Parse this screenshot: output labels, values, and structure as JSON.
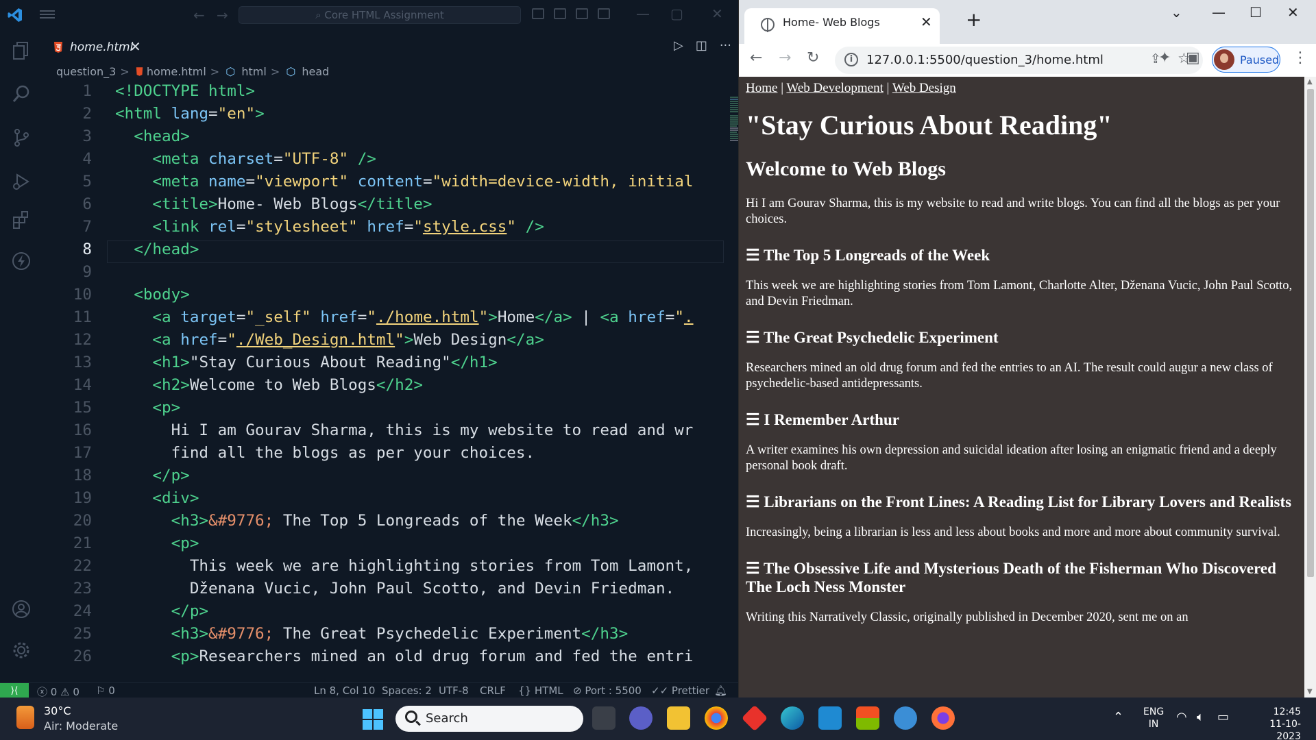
{
  "vscode": {
    "title_search": "Core HTML Assignment",
    "tab": {
      "label": "home.html"
    },
    "breadcrumb": [
      "question_3",
      "home.html",
      "html",
      "head"
    ],
    "cursor_line": 8,
    "lines": [
      {
        "n": "1",
        "html": "<span class='t-tag'>&lt;!DOCTYPE html&gt;</span>"
      },
      {
        "n": "2",
        "html": "<span class='t-tag'>&lt;html</span> <span class='t-attr'>lang</span>=<span class='t-str'>\"en\"</span><span class='t-tag'>&gt;</span>"
      },
      {
        "n": "3",
        "html": "  <span class='t-tag'>&lt;head&gt;</span>"
      },
      {
        "n": "4",
        "html": "    <span class='t-tag'>&lt;meta</span> <span class='t-attr'>charset</span>=<span class='t-str'>\"UTF-8\"</span> <span class='t-tag'>/&gt;</span>"
      },
      {
        "n": "5",
        "html": "    <span class='t-tag'>&lt;meta</span> <span class='t-attr'>name</span>=<span class='t-str'>\"viewport\"</span> <span class='t-attr'>content</span>=<span class='t-str'>\"width=device-width, initial</span>"
      },
      {
        "n": "6",
        "html": "    <span class='t-tag'>&lt;title&gt;</span>Home- Web Blogs<span class='t-tag'>&lt;/title&gt;</span>"
      },
      {
        "n": "7",
        "html": "    <span class='t-tag'>&lt;link</span> <span class='t-attr'>rel</span>=<span class='t-str'>\"stylesheet\"</span> <span class='t-attr'>href</span>=<span class='t-str'>\"</span><span class='t-link'>style.css</span><span class='t-str'>\"</span> <span class='t-tag'>/&gt;</span>"
      },
      {
        "n": "8",
        "html": "  <span class='t-tag'>&lt;/head&gt;</span>"
      },
      {
        "n": "9",
        "html": ""
      },
      {
        "n": "10",
        "html": "  <span class='t-tag'>&lt;body&gt;</span>"
      },
      {
        "n": "11",
        "html": "    <span class='t-tag'>&lt;a</span> <span class='t-attr'>target</span>=<span class='t-str'>\"_self\"</span> <span class='t-attr'>href</span>=<span class='t-str'>\"</span><span class='t-link'>./home.html</span><span class='t-str'>\"</span><span class='t-tag'>&gt;</span>Home<span class='t-tag'>&lt;/a&gt;</span> | <span class='t-tag'>&lt;a</span> <span class='t-attr'>href</span>=<span class='t-str'>\"</span><span class='t-link'>.</span>"
      },
      {
        "n": "12",
        "html": "    <span class='t-tag'>&lt;a</span> <span class='t-attr'>href</span>=<span class='t-str'>\"</span><span class='t-link'>./Web_Design.html</span><span class='t-str'>\"</span><span class='t-tag'>&gt;</span>Web Design<span class='t-tag'>&lt;/a&gt;</span>"
      },
      {
        "n": "13",
        "html": "    <span class='t-tag'>&lt;h1&gt;</span>\"Stay Curious About Reading\"<span class='t-tag'>&lt;/h1&gt;</span>"
      },
      {
        "n": "14",
        "html": "    <span class='t-tag'>&lt;h2&gt;</span>Welcome to Web Blogs<span class='t-tag'>&lt;/h2&gt;</span>"
      },
      {
        "n": "15",
        "html": "    <span class='t-tag'>&lt;p&gt;</span>"
      },
      {
        "n": "16",
        "html": "      Hi I am Gourav Sharma, this is my website to read and wr"
      },
      {
        "n": "17",
        "html": "      find all the blogs as per your choices."
      },
      {
        "n": "18",
        "html": "    <span class='t-tag'>&lt;/p&gt;</span>"
      },
      {
        "n": "19",
        "html": "    <span class='t-tag'>&lt;div&gt;</span>"
      },
      {
        "n": "20",
        "html": "      <span class='t-tag'>&lt;h3&gt;</span><span class='t-ent'>&amp;#9776;</span> The Top 5 Longreads of the Week<span class='t-tag'>&lt;/h3&gt;</span>"
      },
      {
        "n": "21",
        "html": "      <span class='t-tag'>&lt;p&gt;</span>"
      },
      {
        "n": "22",
        "html": "        This week we are highlighting stories from Tom Lamont,"
      },
      {
        "n": "23",
        "html": "        Dženana Vucic, John Paul Scotto, and Devin Friedman."
      },
      {
        "n": "24",
        "html": "      <span class='t-tag'>&lt;/p&gt;</span>"
      },
      {
        "n": "25",
        "html": "      <span class='t-tag'>&lt;h3&gt;</span><span class='t-ent'>&amp;#9776;</span> The Great Psychedelic Experiment<span class='t-tag'>&lt;/h3&gt;</span>"
      },
      {
        "n": "26",
        "html": "      <span class='t-tag'>&lt;p&gt;</span>Researchers mined an old drug forum and fed the entri"
      }
    ],
    "status": {
      "errors": "0",
      "warnings": "0",
      "ports": "0",
      "position": "Ln 8, Col 10",
      "spaces": "Spaces: 2",
      "encoding": "UTF-8",
      "eol": "CRLF",
      "language": "HTML",
      "port": "Port : 5500",
      "formatter": "Prettier"
    }
  },
  "chrome": {
    "tab_title": "Home- Web Blogs",
    "url": "127.0.0.1:5500/question_3/home.html",
    "profile_label": "Paused"
  },
  "page": {
    "nav": [
      "Home",
      "Web Development",
      "Web Design"
    ],
    "nav_sep": "|",
    "h1": "\"Stay Curious About Reading\"",
    "h2": "Welcome to Web Blogs",
    "intro": "Hi I am Gourav Sharma, this is my website to read and write blogs. You can find all the blogs as per your choices.",
    "articles": [
      {
        "title": "☰ The Top 5 Longreads of the Week",
        "body": "This week we are highlighting stories from Tom Lamont, Charlotte Alter, Dženana Vucic, John Paul Scotto, and Devin Friedman."
      },
      {
        "title": "☰ The Great Psychedelic Experiment",
        "body": "Researchers mined an old drug forum and fed the entries to an AI. The result could augur a new class of psychedelic-based antidepressants."
      },
      {
        "title": "☰ I Remember Arthur",
        "body": "A writer examines his own depression and suicidal ideation after losing an enigmatic friend and a deeply personal book draft."
      },
      {
        "title": "☰ Librarians on the Front Lines: A Reading List for Library Lovers and Realists",
        "body": "Increasingly, being a librarian is less and less about books and more and more about community survival."
      },
      {
        "title": "☰ The Obsessive Life and Mysterious Death of the Fisherman Who Discovered The Loch Ness Monster",
        "body": "Writing this Narratively Classic, originally published in December 2020, sent me on an"
      }
    ]
  },
  "taskbar": {
    "weather_temp": "30°C",
    "weather_desc": "Air: Moderate",
    "search_label": "Search",
    "lang_line1": "ENG",
    "lang_line2": "IN",
    "time": "12:45",
    "date": "11-10-2023"
  },
  "colors": {
    "vscode_bg": "#0f1824",
    "tag": "#4ed28e",
    "attr": "#7cc4f5",
    "string": "#f3d47c",
    "page_bg": "#3b3534",
    "remote_green": "#2fa84f"
  }
}
